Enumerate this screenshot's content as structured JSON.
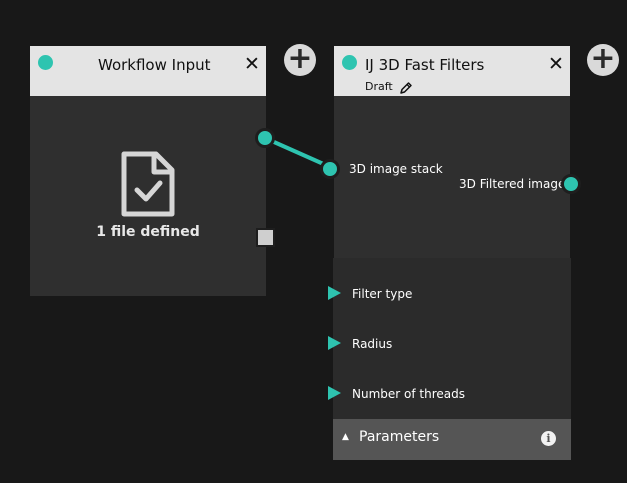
{
  "colors": {
    "accent": "#2ec4b0",
    "header_bg": "#e4e4e4",
    "node_bg": "#2f2f2f",
    "canvas_bg": "#181818",
    "params_bar_bg": "#555555"
  },
  "workflow_input": {
    "title": "Workflow Input",
    "close_glyph": "✕",
    "files_label": "1 file defined",
    "file_icon": "file-check-icon"
  },
  "filter_node": {
    "title": "IJ 3D Fast Filters",
    "status": "Draft",
    "edit_icon": "pencil-icon",
    "close_glyph": "✕",
    "input_port_label": "3D image stack",
    "output_port_label": "3D Filtered image",
    "parameters": [
      {
        "label": "Filter type"
      },
      {
        "label": "Radius"
      },
      {
        "label": "Number of threads"
      }
    ],
    "parameters_bar": {
      "label": "Parameters",
      "toggle_glyph": "▲",
      "info_icon": "info-icon"
    }
  },
  "add_button_glyph": "+"
}
